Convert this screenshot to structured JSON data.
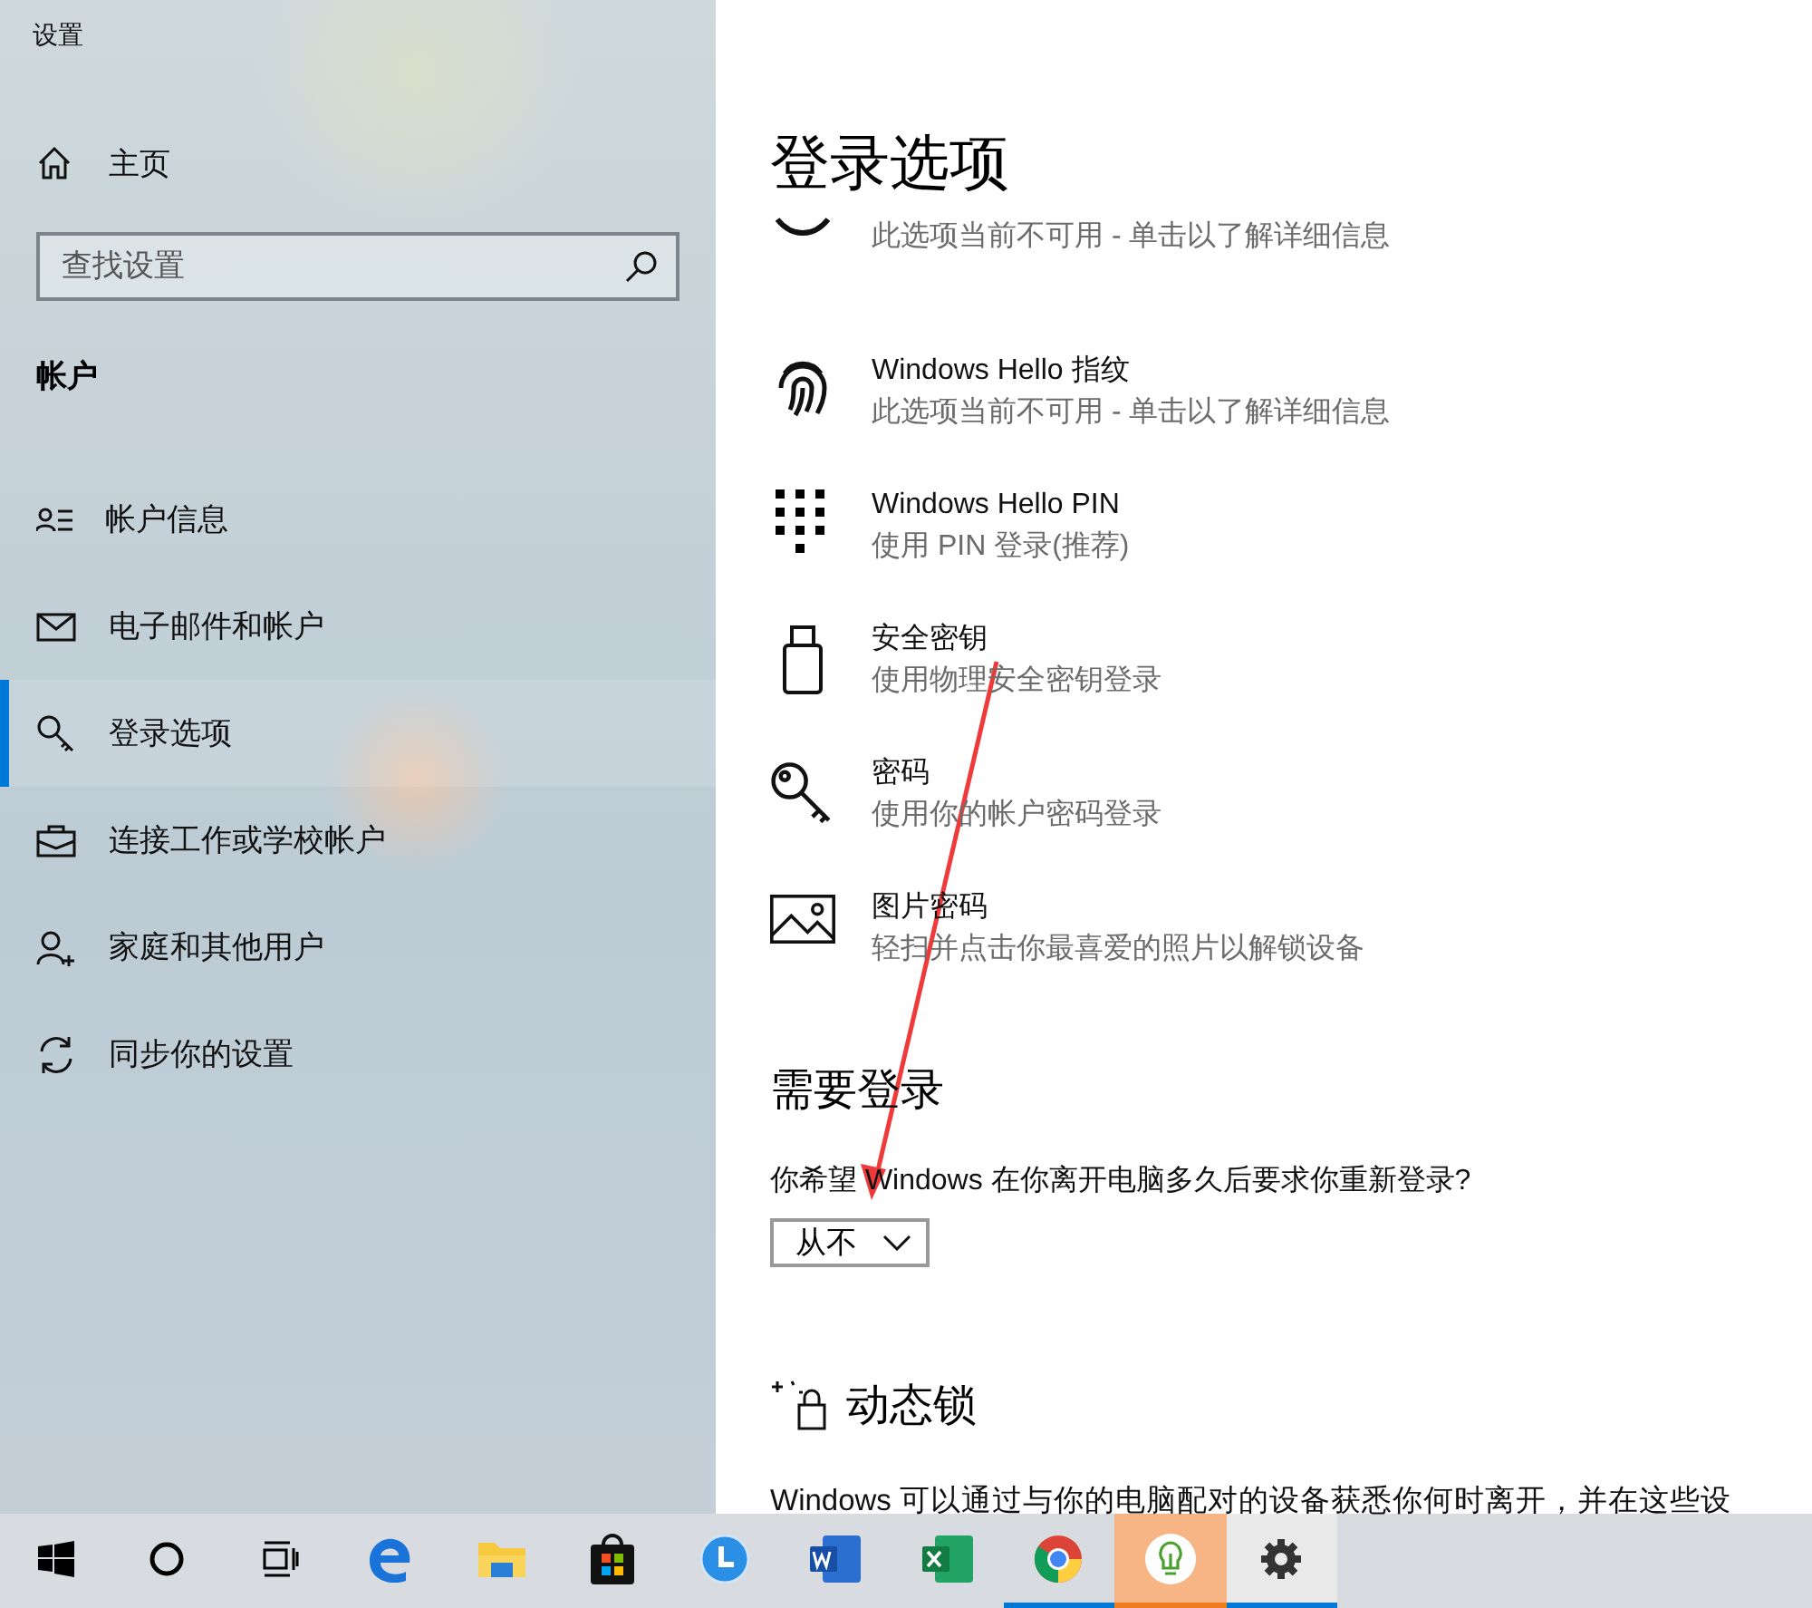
{
  "window": {
    "title": "设置"
  },
  "sidebar": {
    "home": "主页",
    "search": {
      "placeholder": "查找设置"
    },
    "section": "帐户",
    "items": [
      {
        "label": "帐户信息",
        "selected": false
      },
      {
        "label": "电子邮件和帐户",
        "selected": false
      },
      {
        "label": "登录选项",
        "selected": true
      },
      {
        "label": "连接工作或学校帐户",
        "selected": false
      },
      {
        "label": "家庭和其他用户",
        "selected": false
      },
      {
        "label": "同步你的设置",
        "selected": false
      }
    ]
  },
  "page": {
    "title": "登录选项",
    "options": [
      {
        "kind": "face",
        "subtitle": "此选项当前不可用 - 单击以了解详细信息"
      },
      {
        "kind": "fingerprint",
        "title": "Windows Hello 指纹",
        "subtitle": "此选项当前不可用 - 单击以了解详细信息"
      },
      {
        "kind": "pin",
        "title": "Windows Hello PIN",
        "subtitle": "使用 PIN 登录(推荐)"
      },
      {
        "kind": "usb",
        "title": "安全密钥",
        "subtitle": "使用物理安全密钥登录"
      },
      {
        "kind": "key",
        "title": "密码",
        "subtitle": "使用你的帐户密码登录"
      },
      {
        "kind": "picture",
        "title": "图片密码",
        "subtitle": "轻扫并点击你最喜爱的照片以解锁设备"
      }
    ],
    "require_signin": {
      "heading": "需要登录",
      "question": "你希望 Windows 在你离开电脑多久后要求你重新登录?",
      "dropdown": "从不"
    },
    "dynamic_lock": {
      "heading": "动态锁",
      "text": "Windows 可以通过与你的电脑配对的设备获悉你何时离开，并在这些设"
    }
  },
  "taskbar": [
    {
      "kind": "start",
      "running": false,
      "flashing": false,
      "selected": false
    },
    {
      "kind": "search",
      "running": false,
      "flashing": false,
      "selected": false
    },
    {
      "kind": "taskview",
      "running": false,
      "flashing": false,
      "selected": false
    },
    {
      "kind": "edge",
      "running": false,
      "flashing": false,
      "selected": false
    },
    {
      "kind": "explorer",
      "running": false,
      "flashing": false,
      "selected": false
    },
    {
      "kind": "store",
      "running": false,
      "flashing": false,
      "selected": false
    },
    {
      "kind": "clock-app",
      "running": false,
      "flashing": false,
      "selected": false
    },
    {
      "kind": "word",
      "running": false,
      "flashing": false,
      "selected": false
    },
    {
      "kind": "excel",
      "running": false,
      "flashing": false,
      "selected": false
    },
    {
      "kind": "chrome",
      "running": true,
      "flashing": false,
      "selected": false
    },
    {
      "kind": "bulb-app",
      "running": true,
      "flashing": true,
      "selected": false
    },
    {
      "kind": "settings",
      "running": true,
      "flashing": false,
      "selected": true
    }
  ]
}
